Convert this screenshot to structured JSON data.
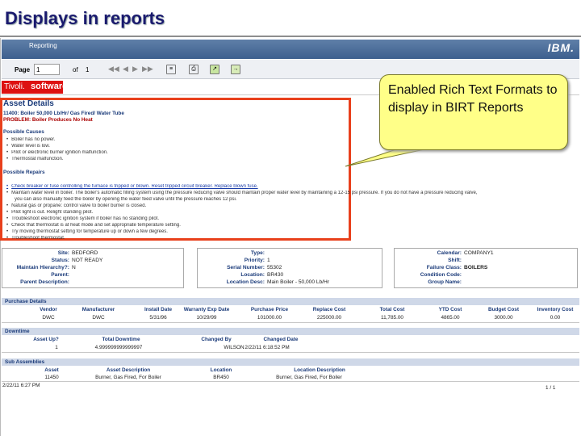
{
  "slide_title": "Displays in reports",
  "topbar": {
    "app_name": "Reporting",
    "brand": "IBM."
  },
  "toolbar": {
    "page_label": "Page",
    "page_value": "1",
    "of_label": "of",
    "total_pages": "1"
  },
  "logo": {
    "brand": "Tivoli.",
    "product": "software"
  },
  "callout": {
    "text": "Enabled Rich Text Formats to display in BIRT Reports"
  },
  "asset_details": {
    "heading": "Asset Details",
    "asset_line": "11400: Boiler 50,000 Lb/Hr/ Gas Fired/ Water Tube",
    "problem_line": "PROBLEM: Boiler Produces No Heat",
    "causes_heading": "Possible Causes",
    "causes": [
      "Boiler has no power.",
      "Water level is low.",
      "Pilot or electronic burner ignition malfunction.",
      "Thermostat malfunction."
    ],
    "repairs_heading": "Possible Repairs",
    "repairs": [
      "Check breaker or fuse controlling the furnace is tripped or blown. Reset tripped circuit breaker. Replace blown fuse.",
      "Maintain water level in boiler. The boiler's automatic filling system using the pressure reducing valve should maintain proper water level by maintaining a 12-15 psi pressure. If you do not have a pressure reducing valve,",
      "you can also manually feed the boiler by opening the water feed valve until the pressure reaches 12 psi.",
      "Natural gas or propane: control valve to boiler burner is closed.",
      "Pilot light is out. Relight standing pilot.",
      "Troubleshoot electronic ignition system if boiler has no standing pilot.",
      "Check that thermostat is at heat mode and set appropriate temperature setting.",
      "Try moving thermostat setting for temperature up or down a few degrees.",
      "Troubleshoot thermostat."
    ]
  },
  "info_table": {
    "col1": [
      {
        "label": "Site:",
        "value": "BEDFORD"
      },
      {
        "label": "Status:",
        "value": "NOT READY"
      },
      {
        "label": "Maintain Hierarchy?:",
        "value": "N"
      },
      {
        "label": "Parent:",
        "value": ""
      },
      {
        "label": "Parent Description:",
        "value": ""
      }
    ],
    "col2": [
      {
        "label": "Type:",
        "value": ""
      },
      {
        "label": "Priority:",
        "value": "1"
      },
      {
        "label": "Serial Number:",
        "value": "55302"
      },
      {
        "label": "Location:",
        "value": "BR430"
      },
      {
        "label": "Location Desc:",
        "value": "Main Boiler - 50,000 Lb/Hr"
      }
    ],
    "col3": [
      {
        "label": "Calendar:",
        "value": "COMPANY1"
      },
      {
        "label": "Shift:",
        "value": ""
      },
      {
        "label": "Failure Class:",
        "value": "BOILERS"
      },
      {
        "label": "Condition Code:",
        "value": ""
      },
      {
        "label": "Group Name:",
        "value": ""
      }
    ]
  },
  "purchase": {
    "band": "Purchase Details",
    "headers": [
      "Vendor",
      "Manufacturer",
      "Install Date",
      "Warranty Exp Date",
      "Purchase Price",
      "Replace Cost",
      "Total Cost",
      "YTD Cost",
      "Budget Cost",
      "Inventory Cost"
    ],
    "row": [
      "DWC",
      "DWC",
      "5/31/96",
      "10/29/99",
      "101000.00",
      "225000.00",
      "11,785.00",
      "4865.00",
      "3000.00",
      "0.00"
    ]
  },
  "downtime": {
    "band": "Downtime",
    "headers": [
      "Asset Up?",
      "Total Downtime",
      "Changed By",
      "Changed Date"
    ],
    "row": [
      "1",
      "4.999999999999997",
      "WILSON",
      "2/22/11 6:18:52 PM"
    ]
  },
  "subassemblies": {
    "band": "Sub Assemblies",
    "headers": [
      "Asset",
      "Asset Description",
      "Location",
      "Location Description"
    ],
    "row": [
      "11450",
      "Burner, Gas Fired, For Boiler",
      "BR450",
      "Burner, Gas Fired, For Boiler"
    ]
  },
  "footer": {
    "timestamp": "2/22/11 6:27 PM",
    "paging": "1 / 1"
  }
}
